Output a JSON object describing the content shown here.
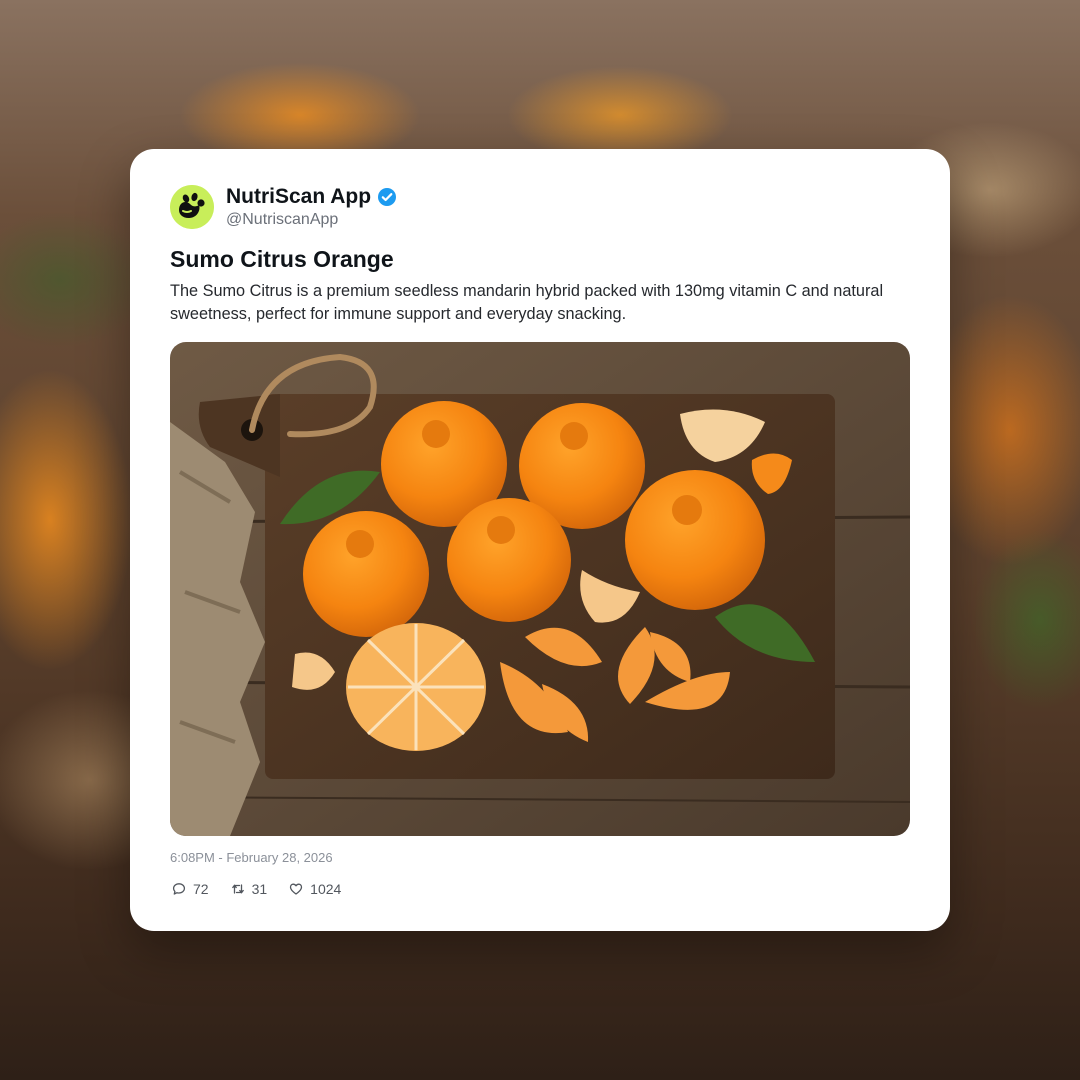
{
  "post": {
    "account_name": "NutriScan App",
    "handle": "@NutriscanApp",
    "title": "Sumo Citrus Orange",
    "body": "The Sumo Citrus is a premium seedless mandarin hybrid packed with 130mg vitamin C and natural sweetness, perfect for immune support and everyday snacking.",
    "timestamp": "6:08PM - February 28, 2026",
    "stats": {
      "replies": "72",
      "reposts": "31",
      "likes": "1024"
    }
  },
  "icons": {
    "avatar": "leaf-logo-icon",
    "verified": "verified-badge-icon",
    "reply": "comment-icon",
    "repost": "repost-icon",
    "like": "heart-icon"
  },
  "colors": {
    "avatar_bg": "#c8ee5a",
    "verified": "#1d9bf0",
    "card_bg": "#ffffff"
  }
}
